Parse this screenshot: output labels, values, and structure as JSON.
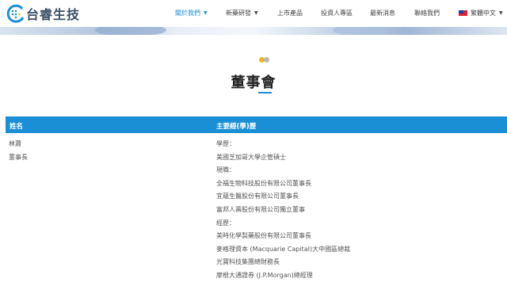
{
  "brand": {
    "name": "台睿生技",
    "accent": "#1a8fd6",
    "dot_active": "#f2b21b"
  },
  "nav": {
    "items": [
      {
        "label": "關於我們",
        "active": true,
        "has_caret": true
      },
      {
        "label": "新藥研發",
        "active": false,
        "has_caret": true
      },
      {
        "label": "上市產品",
        "active": false,
        "has_caret": false
      },
      {
        "label": "投資人專區",
        "active": false,
        "has_caret": false
      },
      {
        "label": "最新消息",
        "active": false,
        "has_caret": false
      },
      {
        "label": "聯絡我們",
        "active": false,
        "has_caret": false
      }
    ],
    "language": {
      "label": "繁體中文",
      "icon": "taiwan-flag-icon"
    }
  },
  "page": {
    "title": "董事會"
  },
  "table": {
    "headers": {
      "name": "姓名",
      "background": "主要經(學)歷"
    },
    "rows": [
      {
        "name": "林蕭",
        "role": "董事長",
        "background": [
          "學歷：",
          "美國芝加哥大學企管碩士",
          "現職：",
          "全福生物科技股份有限公司董事長",
          "宜蘊生醫股份有限公司董事長",
          "富邦人壽股份有限公司獨立董事",
          "經歷：",
          "美時化學製藥股份有限公司董事長",
          "麥格理資本 (Macquarie Capital)大中國區總裁",
          "光寶科技集團總財務長",
          "摩根大通證券 (J.P.Morgan)總經理"
        ]
      }
    ]
  }
}
